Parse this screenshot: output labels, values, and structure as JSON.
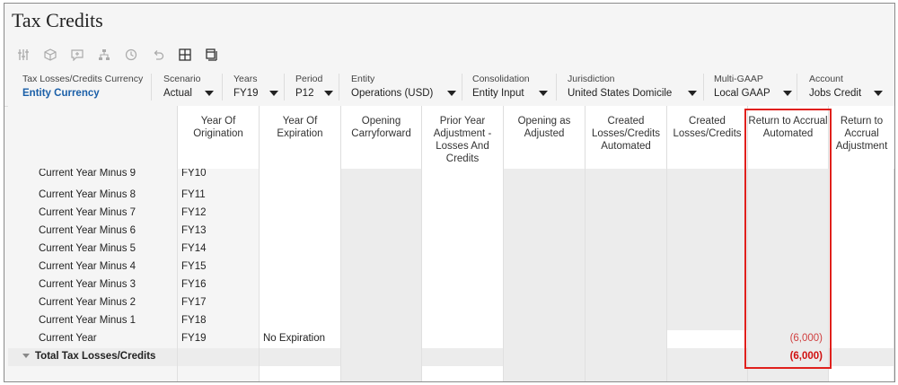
{
  "page_title": "Tax Credits",
  "toolbar": {
    "icons": [
      "sliders-icon",
      "cube-icon",
      "comment-icon",
      "hierarchy-icon",
      "history-icon",
      "undo-icon",
      "grid-icon",
      "freeze-panes-icon"
    ]
  },
  "pov": [
    {
      "label": "Tax Losses/Credits Currency",
      "value": "Entity Currency",
      "dropdown": false
    },
    {
      "label": "Scenario",
      "value": "Actual",
      "dropdown": true
    },
    {
      "label": "Years",
      "value": "FY19",
      "dropdown": true
    },
    {
      "label": "Period",
      "value": "P12",
      "dropdown": true
    },
    {
      "label": "Entity",
      "value": "Operations (USD)",
      "dropdown": true
    },
    {
      "label": "Consolidation",
      "value": "Entity Input",
      "dropdown": true
    },
    {
      "label": "Jurisdiction",
      "value": "United States Domicile",
      "dropdown": true
    },
    {
      "label": "Multi-GAAP",
      "value": "Local GAAP",
      "dropdown": true
    },
    {
      "label": "Account",
      "value": "Jobs Credit",
      "dropdown": true
    }
  ],
  "grid": {
    "columns": [
      "Year Of Origination",
      "Year Of Expiration",
      "Opening Carryforward",
      "Prior Year Adjustment - Losses And Credits",
      "Opening as Adjusted",
      "Created Losses/Credits Automated",
      "Created Losses/Credits",
      "Return to Accrual Automated",
      "Return to Accrual Adjustment"
    ],
    "rows": [
      {
        "label": "Current Year Minus 9",
        "origination": "FY10",
        "expiration": "",
        "rta": ""
      },
      {
        "label": "Current Year Minus 8",
        "origination": "FY11",
        "expiration": "",
        "rta": ""
      },
      {
        "label": "Current Year Minus 7",
        "origination": "FY12",
        "expiration": "",
        "rta": ""
      },
      {
        "label": "Current Year Minus 6",
        "origination": "FY13",
        "expiration": "",
        "rta": ""
      },
      {
        "label": "Current Year Minus 5",
        "origination": "FY14",
        "expiration": "",
        "rta": ""
      },
      {
        "label": "Current Year Minus 4",
        "origination": "FY15",
        "expiration": "",
        "rta": ""
      },
      {
        "label": "Current Year Minus 3",
        "origination": "FY16",
        "expiration": "",
        "rta": ""
      },
      {
        "label": "Current Year Minus 2",
        "origination": "FY17",
        "expiration": "",
        "rta": ""
      },
      {
        "label": "Current Year Minus 1",
        "origination": "FY18",
        "expiration": "",
        "rta": ""
      },
      {
        "label": "Current Year",
        "origination": "FY19",
        "expiration": "No Expiration",
        "rta": "(6,000)"
      }
    ],
    "total": {
      "label": "Total Tax Losses/Credits",
      "rta": "(6,000)"
    }
  },
  "colors": {
    "highlight_box": "#e0201c",
    "negative": "#d04040",
    "link": "#1a5fa8"
  }
}
